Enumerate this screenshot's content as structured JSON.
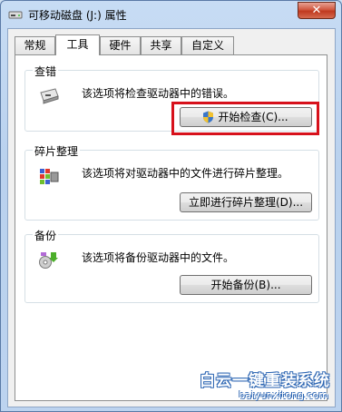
{
  "window": {
    "title": "可移动磁盘 (J:) 属性",
    "close_label": "✕",
    "icon": "drive-icon"
  },
  "tabs": [
    {
      "label": "常规",
      "active": false
    },
    {
      "label": "工具",
      "active": true
    },
    {
      "label": "硬件",
      "active": false
    },
    {
      "label": "共享",
      "active": false
    },
    {
      "label": "自定义",
      "active": false
    }
  ],
  "groups": {
    "error_check": {
      "title": "查错",
      "description": "该选项将检查驱动器中的错误。",
      "button_label": "开始检查(C)...",
      "icon": "drive-check-icon"
    },
    "defrag": {
      "title": "碎片整理",
      "description": "该选项将对驱动器中的文件进行碎片整理。",
      "button_label": "立即进行碎片整理(D)...",
      "icon": "defrag-icon"
    },
    "backup": {
      "title": "备份",
      "description": "该选项将备份驱动器中的文件。",
      "button_label": "开始备份(B)...",
      "icon": "backup-icon"
    }
  },
  "watermark": {
    "title": "白云一键重装系统",
    "url": "baiyunxitong.com"
  },
  "colors": {
    "highlight": "#d7111b",
    "title_bar": "#c7dcf4"
  }
}
